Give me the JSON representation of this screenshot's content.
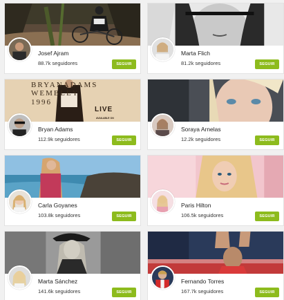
{
  "follow_label": "SEGUIR",
  "cards": [
    {
      "name": "Josef Ajram",
      "followers": "88.7k seguidores"
    },
    {
      "name": "Marta Flich",
      "followers": "81.2k seguidores"
    },
    {
      "name": "Bryan Adams",
      "followers": "112.9k seguidores",
      "cover_text": {
        "line1": "BRYANADAMS",
        "line2": "WEMBLEY",
        "line3": "1996",
        "live": "LIVE",
        "small": "AVAILABLE ON"
      }
    },
    {
      "name": "Soraya Arnelas",
      "followers": "12.2k seguidores"
    },
    {
      "name": "Carla Goyanes",
      "followers": "103.8k seguidores"
    },
    {
      "name": "Paris Hilton",
      "followers": "106.5k seguidores"
    },
    {
      "name": "Marta Sánchez",
      "followers": "141.6k seguidores"
    },
    {
      "name": "Fernando Torres",
      "followers": "167.7k seguidores"
    }
  ],
  "colors": {
    "accent": "#8dbb1d"
  }
}
